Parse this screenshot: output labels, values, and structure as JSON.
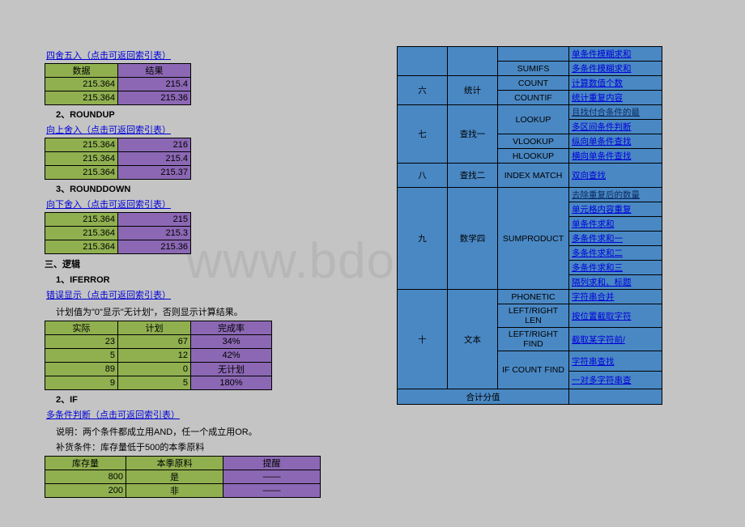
{
  "watermark": "www.bdocx.com",
  "left": {
    "round_link": "四舍五入（点击可返回索引表）",
    "h_data": "数据",
    "h_result": "结果",
    "round_rows": [
      {
        "d": "215.364",
        "r": "215.4"
      },
      {
        "d": "215.364",
        "r": "215.36"
      }
    ],
    "sec2": "2、ROUNDUP",
    "roundup_link": "向上舍入（点击可返回索引表）",
    "roundup_rows": [
      {
        "d": "215.364",
        "r": "216"
      },
      {
        "d": "215.364",
        "r": "215.4"
      },
      {
        "d": "215.364",
        "r": "215.37"
      }
    ],
    "sec3": "3、ROUNDDOWN",
    "rounddown_link": "向下舍入（点击可返回索引表）",
    "rounddown_rows": [
      {
        "d": "215.364",
        "r": "215"
      },
      {
        "d": "215.364",
        "r": "215.3"
      },
      {
        "d": "215.364",
        "r": "215.36"
      }
    ],
    "logic_title": "三、逻辑",
    "sec_iferr": "1、IFERROR",
    "iferr_link": "错误显示（点击可返回索引表）",
    "iferr_note": "计划值为\"0\"显示\"无计划\"，否则显示计算结果。",
    "h_actual": "实际",
    "h_plan": "计划",
    "h_rate": "完成率",
    "iferr_rows": [
      {
        "a": "23",
        "p": "67",
        "r": "34%"
      },
      {
        "a": "5",
        "p": "12",
        "r": "42%"
      },
      {
        "a": "89",
        "p": "0",
        "r": "无计划"
      },
      {
        "a": "9",
        "p": "5",
        "r": "180%"
      }
    ],
    "sec_if": "2、IF",
    "if_link": "多条件判断（点击可返回索引表）",
    "if_note1": "说明：两个条件都成立用AND，任一个成立用OR。",
    "if_note2": "补货条件：库存量低于500的本季原料",
    "h_stock": "库存量",
    "h_mat": "本季原料",
    "h_warn": "提醒",
    "if_rows": [
      {
        "s": "800",
        "m": "是",
        "w": "——"
      },
      {
        "s": "200",
        "m": "非",
        "w": "——"
      }
    ]
  },
  "right": {
    "top_link": "单条件模糊求和",
    "rows": [
      {
        "num": "",
        "cat": "",
        "fn": "SUMIFS",
        "link": "多条件模糊求和"
      },
      {
        "num": "六",
        "cat": "统计",
        "fn": "COUNT",
        "link": "计算数值个数",
        "span": 2
      },
      {
        "fn": "COUNTIF",
        "link": "统计重复内容"
      },
      {
        "num": "七",
        "cat": "查找一",
        "fn": "LOOKUP",
        "link": "且找付合条件的最",
        "dark": true,
        "span": 3,
        "fnspan": 1
      },
      {
        "link": "多区间条件判断",
        "fn": "",
        "samefn": true
      },
      {
        "fn": "VLOOKUP",
        "link": "纵向单条件查找"
      },
      {
        "fn": "HLOOKUP",
        "link": "横向单条件查找",
        "outrow": true
      },
      {
        "num": "八",
        "cat": "查找二",
        "fn": "INDEX MATCH",
        "link": "双向查找",
        "span": 1
      },
      {
        "num": "九",
        "cat": "数学四",
        "fn": "SUMPRODUCT",
        "span": 6,
        "links": [
          {
            "t": "去除重复后的数量",
            "dark": true
          },
          {
            "t": "单元格内容重复"
          },
          {
            "t": "单条件求和"
          },
          {
            "t": "多条件求和一"
          },
          {
            "t": "多条件求和二"
          },
          {
            "t": "多条件求和三"
          }
        ]
      },
      {
        "link": "隔列求和、标题"
      },
      {
        "num": "十",
        "cat": "文本",
        "span": 5,
        "items": [
          {
            "fn": "PHONETIC",
            "link": "字符串合并"
          },
          {
            "fn": "LEFT/RIGHT LEN",
            "link": "按位置截取字符"
          },
          {
            "fn": "LEFT/RIGHT FIND",
            "link": "截取某字符前/"
          },
          {
            "fn": "IF COUNT FIND",
            "link": "字符串查找",
            "fnspan": 2
          },
          {
            "link": "一对多字符串查"
          }
        ]
      },
      {
        "footer": "合计分值"
      }
    ]
  }
}
